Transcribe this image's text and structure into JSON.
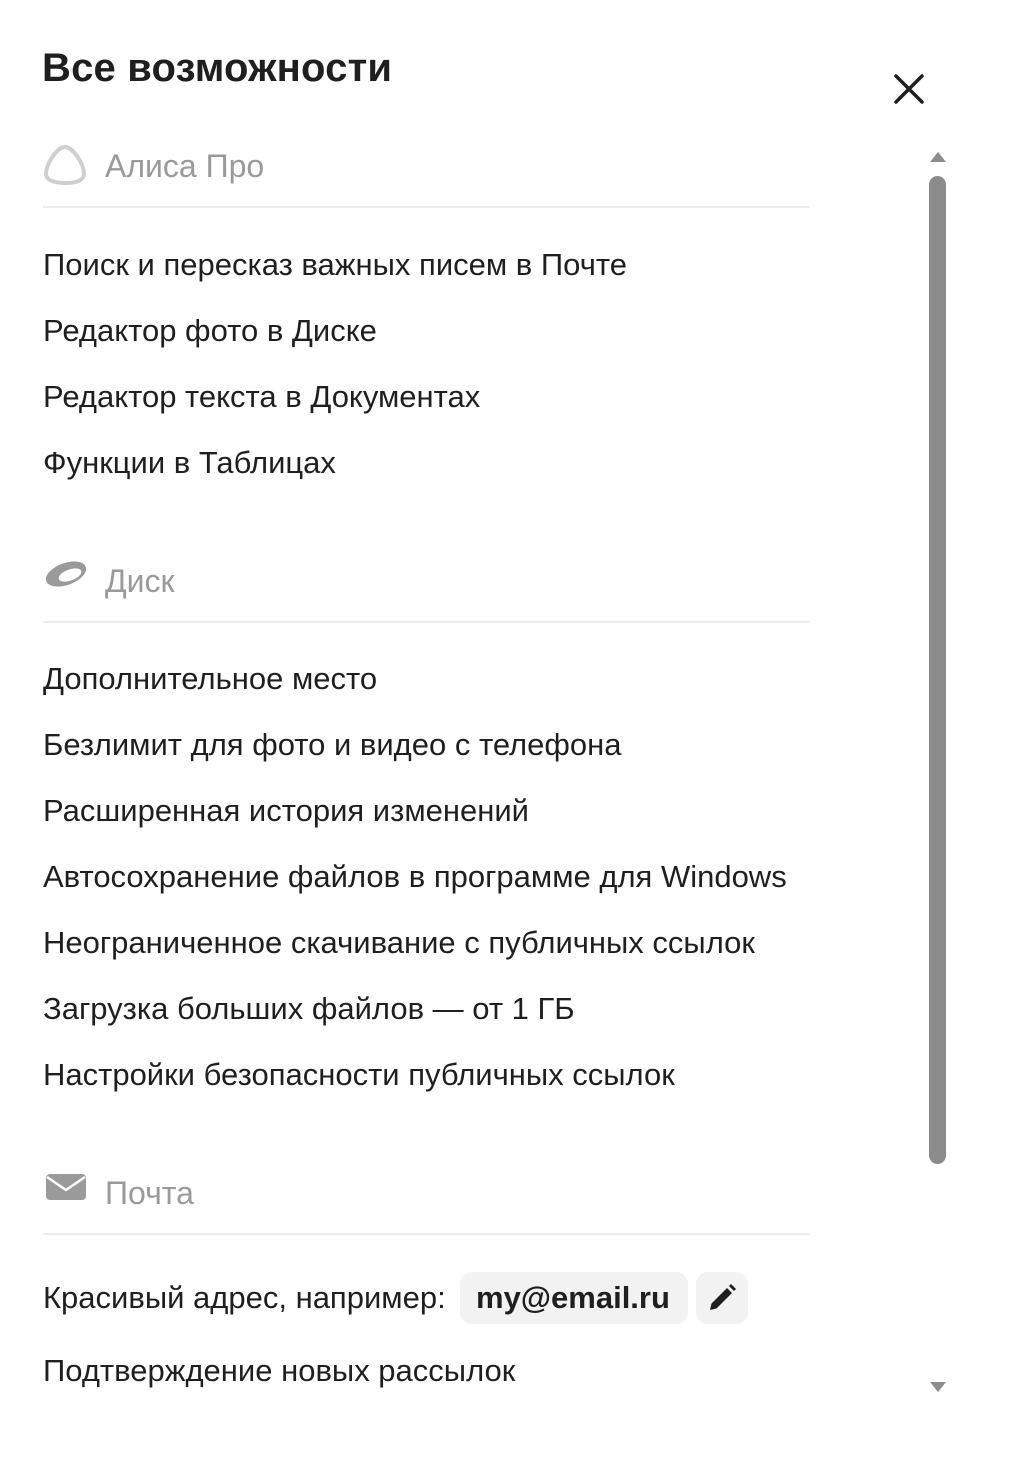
{
  "dialog": {
    "title": "Все возможности",
    "close_icon": "close-icon"
  },
  "sections": {
    "alice": {
      "label": "Алиса Про",
      "icon": "alice-icon",
      "items": [
        "Поиск и пересказ важных писем в Почте",
        "Редактор фото в Диске",
        "Редактор текста в Документах",
        "Функции в Таблицах"
      ]
    },
    "disk": {
      "label": "Диск",
      "icon": "disk-icon",
      "items": [
        "Дополнительное место",
        "Безлимит для фото и видео с телефона",
        "Расширенная история изменений",
        "Автосохранение файлов в программе для Windows",
        "Неограниченное скачивание с публичных ссылок",
        "Загрузка больших файлов — от 1 ГБ",
        "Настройки безопасности публичных ссылок"
      ]
    },
    "mail": {
      "label": "Почта",
      "icon": "envelope-icon",
      "address_label": "Красивый адрес, например:",
      "address_example": "my@email.ru",
      "edit_icon": "pencil-icon",
      "items": [
        "Подтверждение новых рассылок"
      ]
    }
  },
  "colors": {
    "text": "#1f1f1f",
    "muted": "#9a9a9a",
    "divider": "#ececec",
    "chip_bg": "#f2f2f2",
    "scroll_thumb": "#8c8c8c"
  }
}
